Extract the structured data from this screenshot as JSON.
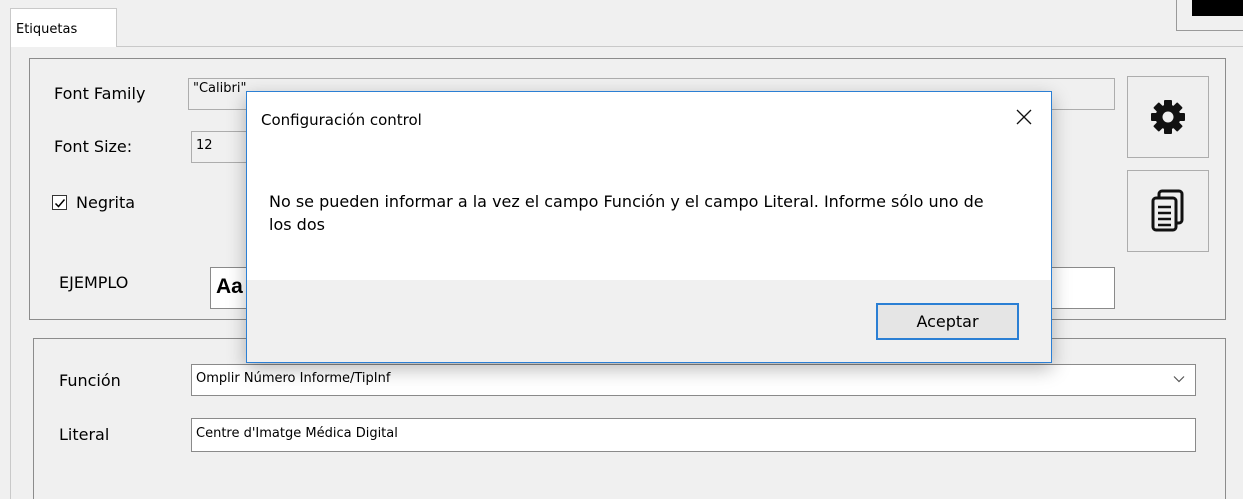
{
  "tab": {
    "label": "Etiquetas"
  },
  "font_group": {
    "font_family_label": "Font Family",
    "font_family_value": "\"Calibri\"",
    "font_size_label": "Font Size:",
    "font_size_value": "12",
    "bold_label": "Negrita",
    "bold_checked": true,
    "example_label": "EJEMPLO",
    "example_preview": "Aa",
    "settings_icon": "gear-icon",
    "copy_icon": "copy-document-icon"
  },
  "field_group": {
    "function_label": "Función",
    "function_value": "Omplir Número Informe/TipInf",
    "literal_label": "Literal",
    "literal_value": "Centre d'Imatge Médica Digital"
  },
  "dialog": {
    "title": "Configuración control",
    "message": "No se pueden informar a la vez el campo Función y el campo Literal. Informe sólo uno de los dos",
    "ok_label": "Aceptar",
    "close_icon": "close-icon"
  },
  "colors": {
    "dialog_border": "#2b7fd4",
    "window_bg": "#f0f0f0"
  }
}
